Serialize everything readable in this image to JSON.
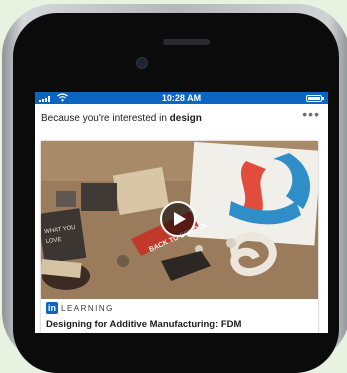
{
  "status_bar": {
    "time": "10:28 AM",
    "signal_icon": "signal-bars-icon",
    "wifi_icon": "wifi-icon",
    "battery_icon": "battery-icon"
  },
  "recommendation": {
    "prefix": "Because you're interested in ",
    "topic": "design",
    "more_icon": "more-horizontal-icon"
  },
  "course_card": {
    "play_icon": "play-icon",
    "brand_logo": "in",
    "brand_name": "LEARNING",
    "title": "Designing for Additive Manufacturing: FDM"
  },
  "colors": {
    "accent": "#0a66c2",
    "background": "#e7f2e0"
  }
}
